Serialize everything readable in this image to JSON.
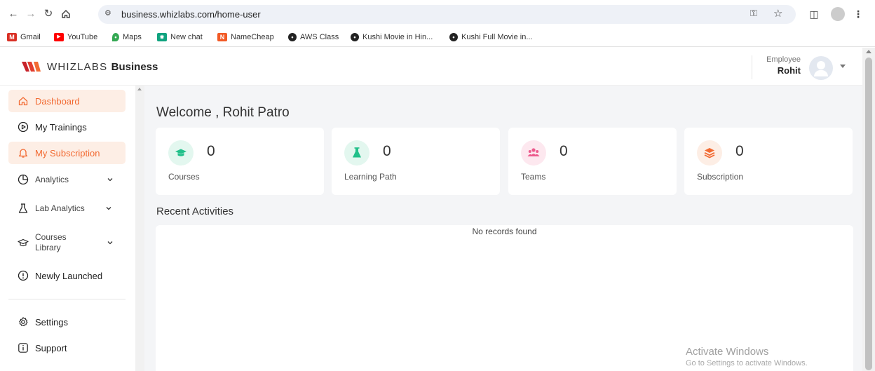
{
  "browser": {
    "url": "business.whizlabs.com/home-user",
    "bookmarks": [
      {
        "label": "Gmail",
        "icon": "gmail-icon",
        "color": "#d93025"
      },
      {
        "label": "YouTube",
        "icon": "youtube-icon",
        "color": "#ff0000"
      },
      {
        "label": "Maps",
        "icon": "maps-icon",
        "color": "#34a853"
      },
      {
        "label": "New chat",
        "icon": "chat-icon",
        "color": "#10a37f"
      },
      {
        "label": "NameCheap",
        "icon": "namecheap-icon",
        "color": "#f25a26"
      },
      {
        "label": "AWS Class",
        "icon": "github-icon",
        "color": "#222222"
      },
      {
        "label": "Kushi Movie in Hin...",
        "icon": "site-icon",
        "color": "#222222"
      },
      {
        "label": "Kushi Full Movie in...",
        "icon": "site-icon",
        "color": "#222222"
      }
    ]
  },
  "header": {
    "logo_brand": "WHIZLABS",
    "logo_suffix": "Business",
    "user_role": "Employee",
    "user_name": "Rohit"
  },
  "sidebar": {
    "items": [
      {
        "label": "Dashboard",
        "icon": "home-icon",
        "active": true
      },
      {
        "label": "My Trainings",
        "icon": "play-circle-icon",
        "active": false
      },
      {
        "label": "My Subscription",
        "icon": "bell-icon",
        "active": true
      },
      {
        "label": "Analytics",
        "icon": "pie-chart-icon",
        "active": false
      },
      {
        "label": "Lab Analytics",
        "icon": "flask-icon",
        "active": false
      },
      {
        "label": "Courses Library",
        "icon": "graduation-cap-icon",
        "active": false
      },
      {
        "label": "Newly Launched",
        "icon": "info-circle-icon",
        "active": false
      },
      {
        "label": "Settings",
        "icon": "gear-icon",
        "active": false
      },
      {
        "label": "Support",
        "icon": "info-square-icon",
        "active": false
      }
    ]
  },
  "main": {
    "welcome": "Welcome , Rohit Patro",
    "cards": [
      {
        "label": "Courses",
        "count": "0",
        "icon": "graduation-cap-icon",
        "color": "#22c08a",
        "bg": "#e3f7ef"
      },
      {
        "label": "Learning Path",
        "count": "0",
        "icon": "flask-icon",
        "color": "#22c08a",
        "bg": "#e3f7ef"
      },
      {
        "label": "Teams",
        "count": "0",
        "icon": "users-icon",
        "color": "#ec5b8d",
        "bg": "#fde8ef"
      },
      {
        "label": "Subscription",
        "count": "0",
        "icon": "layers-icon",
        "color": "#f26a32",
        "bg": "#fdeee5"
      }
    ],
    "recent_title": "Recent Activities",
    "empty_message": "No records found"
  },
  "watermark": {
    "title": "Activate Windows",
    "subtitle": "Go to Settings to activate Windows."
  },
  "colors": {
    "accent": "#f26a32",
    "active_bg": "#fdeee5",
    "main_bg": "#f4f5f7"
  }
}
